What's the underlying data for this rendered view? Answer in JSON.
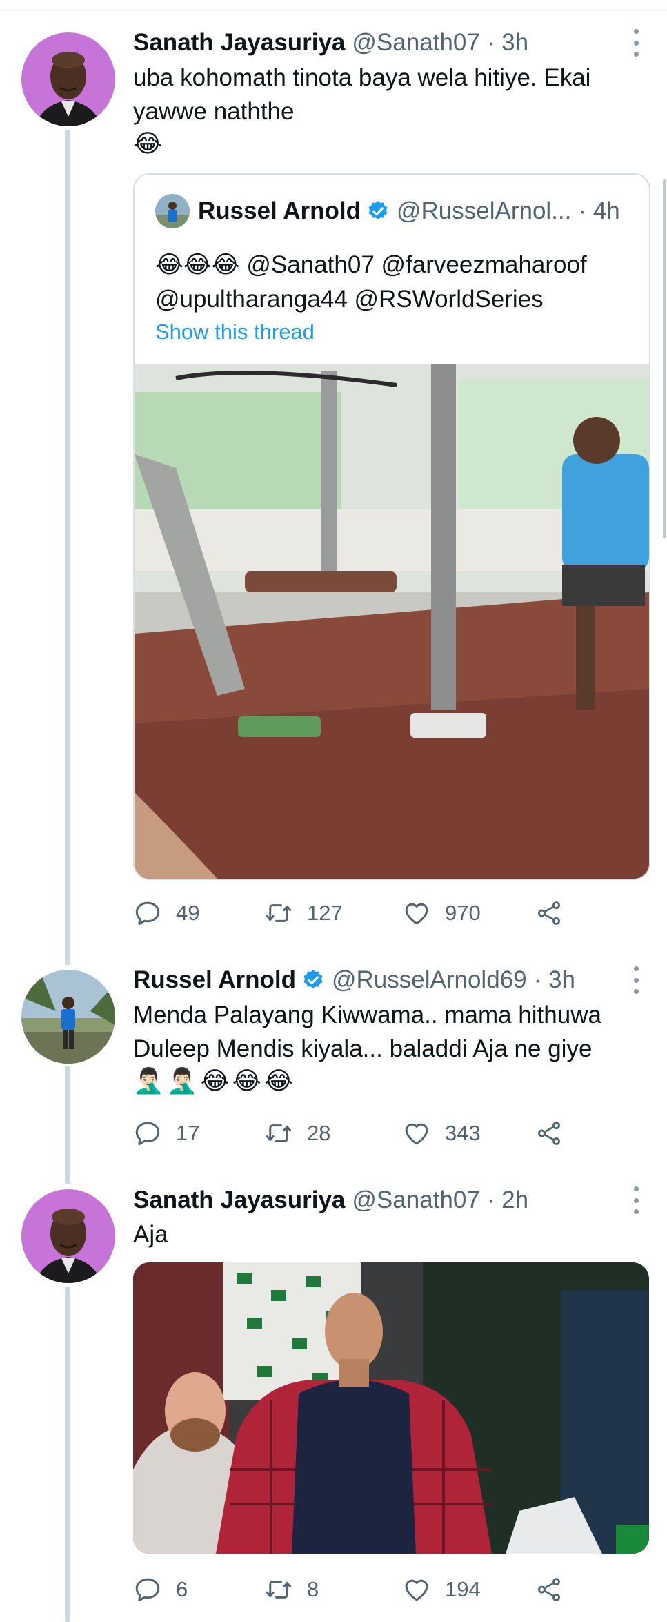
{
  "tweets": [
    {
      "author": "Sanath Jayasuriya",
      "handle": "@Sanath07",
      "time": "· 3h",
      "lines": [
        "uba kohomath tinota baya wela hitiye. Ekai",
        "yawwe naththe"
      ],
      "emoji": "😂",
      "quoted": {
        "author": "Russel Arnold",
        "handle": "@RusselArnol...",
        "time": "· 4h",
        "line1": "😂😂😂 @Sanath07 @farveezmaharoof",
        "line2": "@upultharanga44 @RSWorldSeries",
        "thread_link": "Show this thread",
        "media_icon": "gym-video-thumbnail"
      },
      "stats": {
        "replies": "49",
        "retweets": "127",
        "likes": "970"
      }
    },
    {
      "author": "Russel Arnold",
      "handle": "@RusselArnold69",
      "time": "· 3h",
      "lines": [
        "Menda Palayang Kiwwama.. mama hithuwa",
        "Duleep Mendis kiyala... baladdi Aja ne giye"
      ],
      "emoji": [
        "🤦🏻‍♂️",
        "🤦🏻‍♂️",
        "😂",
        "😂",
        "😂"
      ],
      "stats": {
        "replies": "17",
        "retweets": "28",
        "likes": "343"
      }
    },
    {
      "author": "Sanath Jayasuriya",
      "handle": "@Sanath07",
      "time": "· 2h",
      "lines": [
        "Aja"
      ],
      "media_icon": "cricket-fan-photo",
      "stats": {
        "replies": "6",
        "retweets": "8",
        "likes": "194"
      }
    }
  ],
  "colors": {
    "link": "#1d9bf0",
    "secondary_text": "#536471",
    "verified": "#1d9bf0",
    "thread_line": "#cfd9de"
  }
}
